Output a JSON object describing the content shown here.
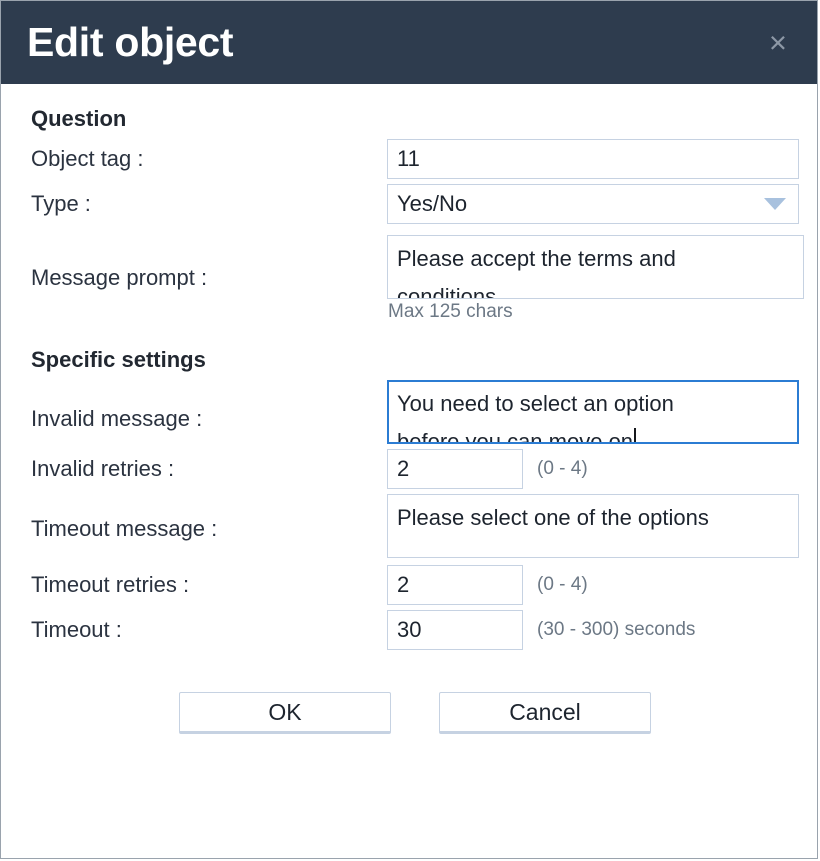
{
  "dialog": {
    "title": "Edit object",
    "close_icon": "close-icon",
    "close_glyph": "×"
  },
  "sections": {
    "question": {
      "heading": "Question",
      "fields": {
        "object_tag": {
          "label": "Object tag :",
          "value": "11"
        },
        "type": {
          "label": "Type :",
          "value": "Yes/No",
          "caret_icon": "chevron-down-icon"
        },
        "message_prompt": {
          "label": "Message prompt :",
          "line1": "Please accept the terms and",
          "line2": "conditions.",
          "hint": "Max 125 chars"
        }
      }
    },
    "specific_settings": {
      "heading": "Specific settings",
      "fields": {
        "invalid_message": {
          "label": "Invalid message :",
          "line1": "You need to select an option",
          "line2": "before you can move on",
          "focused": true
        },
        "invalid_retries": {
          "label": "Invalid retries :",
          "value": "2",
          "hint": "(0 - 4)"
        },
        "timeout_message": {
          "label": "Timeout message :",
          "line1": "Please select one of the options",
          "line2": ""
        },
        "timeout_retries": {
          "label": "Timeout retries :",
          "value": "2",
          "hint": "(0 - 4)"
        },
        "timeout": {
          "label": "Timeout :",
          "value": "30",
          "hint": "(30 - 300) seconds"
        }
      }
    }
  },
  "footer": {
    "ok_label": "OK",
    "cancel_label": "Cancel"
  },
  "colors": {
    "titlebar_bg": "#2e3c4e",
    "field_border": "#c6d2e2",
    "focus_border": "#2b7cd3",
    "hint_text": "#6c7885",
    "caret_fill": "#a8c1de"
  }
}
